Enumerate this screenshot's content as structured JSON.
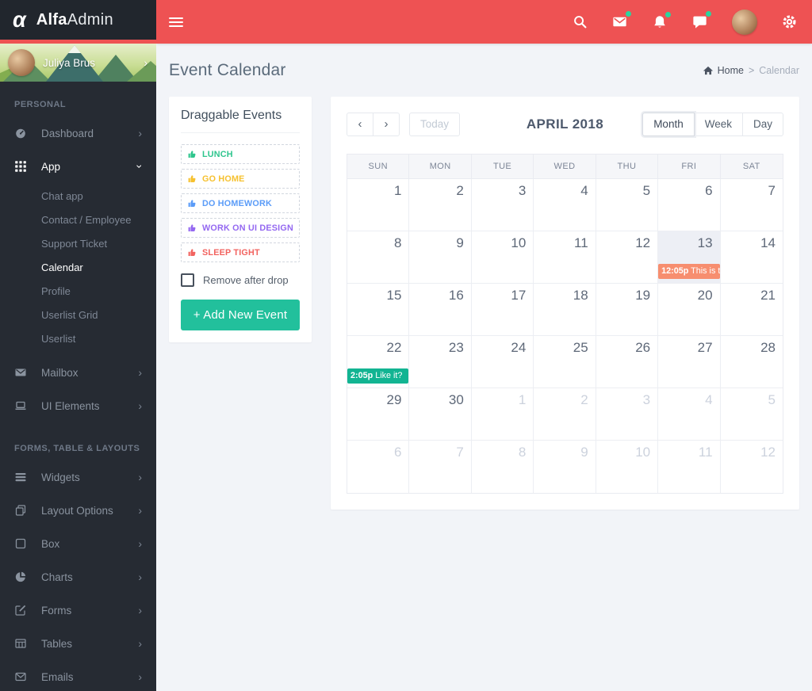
{
  "app": {
    "brand_alpha": "α",
    "brand_bold": "Alfa",
    "brand_light": "Admin"
  },
  "colors": {
    "header_red": "#ee5253",
    "accent_green": "#22c09c",
    "event_green": "#12b492",
    "event_orange": "#f78e6f",
    "badge_green": "#2bd49e",
    "sidebar_bg": "#262b33"
  },
  "topbar": {
    "icons": [
      {
        "name": "search-icon",
        "badge": false
      },
      {
        "name": "mail-icon",
        "badge": true
      },
      {
        "name": "bell-icon",
        "badge": true
      },
      {
        "name": "chat-icon",
        "badge": true
      },
      {
        "name": "user-avatar",
        "badge": false
      },
      {
        "name": "settings-icon",
        "badge": false
      }
    ]
  },
  "sidebar": {
    "user": {
      "name": "Juliya Brus"
    },
    "sections": [
      {
        "label": "PERSONAL",
        "items": [
          {
            "label": "Dashboard",
            "icon": "gauge-icon",
            "chevron": "right"
          },
          {
            "label": "App",
            "icon": "app-grid-icon",
            "chevron": "down",
            "active": true,
            "children": [
              {
                "label": "Chat app"
              },
              {
                "label": "Contact / Employee"
              },
              {
                "label": "Support Ticket"
              },
              {
                "label": "Calendar",
                "active": true
              },
              {
                "label": "Profile"
              },
              {
                "label": "Userlist Grid"
              },
              {
                "label": "Userlist"
              }
            ]
          },
          {
            "label": "Mailbox",
            "icon": "mailbox-icon",
            "chevron": "right"
          },
          {
            "label": "UI Elements",
            "icon": "laptop-icon",
            "chevron": "right"
          }
        ]
      },
      {
        "label": "FORMS, TABLE & LAYOUTS",
        "items": [
          {
            "label": "Widgets",
            "icon": "widgets-icon",
            "chevron": "right"
          },
          {
            "label": "Layout Options",
            "icon": "layout-icon",
            "chevron": "right"
          },
          {
            "label": "Box",
            "icon": "box-icon",
            "chevron": "right"
          },
          {
            "label": "Charts",
            "icon": "pie-chart-icon",
            "chevron": "right"
          },
          {
            "label": "Forms",
            "icon": "edit-icon",
            "chevron": "right"
          },
          {
            "label": "Tables",
            "icon": "table-icon",
            "chevron": "right"
          },
          {
            "label": "Emails",
            "icon": "envelope-icon",
            "chevron": "right"
          }
        ]
      }
    ]
  },
  "page": {
    "title": "Event Calendar",
    "breadcrumb": {
      "home": "Home",
      "separator": ">",
      "current": "Calendar"
    }
  },
  "events_panel": {
    "title": "Draggable Events",
    "events": [
      {
        "label": "LUNCH",
        "color": "#2ec58d"
      },
      {
        "label": "GO HOME",
        "color": "#f6c12f"
      },
      {
        "label": "DO HOMEWORK",
        "color": "#5b9cf8"
      },
      {
        "label": "WORK ON UI DESIGN",
        "color": "#9468f1"
      },
      {
        "label": "SLEEP TIGHT",
        "color": "#f2635f"
      }
    ],
    "checkbox_label": "Remove after drop",
    "checkbox_checked": false,
    "add_button": "+ Add New Event"
  },
  "calendar": {
    "title": "APRIL 2018",
    "prev_icon": "‹",
    "next_icon": "›",
    "today_button": "Today",
    "view_buttons": [
      "Month",
      "Week",
      "Day"
    ],
    "active_view": "Month",
    "day_headers": [
      "SUN",
      "MON",
      "TUE",
      "WED",
      "THU",
      "FRI",
      "SAT"
    ],
    "cells": [
      {
        "day": "1"
      },
      {
        "day": "2"
      },
      {
        "day": "3"
      },
      {
        "day": "4"
      },
      {
        "day": "5"
      },
      {
        "day": "6"
      },
      {
        "day": "7"
      },
      {
        "day": "8"
      },
      {
        "day": "9"
      },
      {
        "day": "10"
      },
      {
        "day": "11"
      },
      {
        "day": "12"
      },
      {
        "day": "13",
        "today": true,
        "event": {
          "time": "12:05p",
          "title": "This is t",
          "color": "#f78e6f"
        }
      },
      {
        "day": "14"
      },
      {
        "day": "15"
      },
      {
        "day": "16"
      },
      {
        "day": "17"
      },
      {
        "day": "18"
      },
      {
        "day": "19"
      },
      {
        "day": "20"
      },
      {
        "day": "21"
      },
      {
        "day": "22",
        "event": {
          "time": "2:05p",
          "title": "Like it?",
          "color": "#12b492"
        }
      },
      {
        "day": "23"
      },
      {
        "day": "24"
      },
      {
        "day": "25"
      },
      {
        "day": "26"
      },
      {
        "day": "27"
      },
      {
        "day": "28"
      },
      {
        "day": "29"
      },
      {
        "day": "30"
      },
      {
        "day": "1",
        "other": true
      },
      {
        "day": "2",
        "other": true
      },
      {
        "day": "3",
        "other": true
      },
      {
        "day": "4",
        "other": true
      },
      {
        "day": "5",
        "other": true
      },
      {
        "day": "6",
        "other": true
      },
      {
        "day": "7",
        "other": true
      },
      {
        "day": "8",
        "other": true
      },
      {
        "day": "9",
        "other": true
      },
      {
        "day": "10",
        "other": true
      },
      {
        "day": "11",
        "other": true
      },
      {
        "day": "12",
        "other": true
      }
    ]
  }
}
